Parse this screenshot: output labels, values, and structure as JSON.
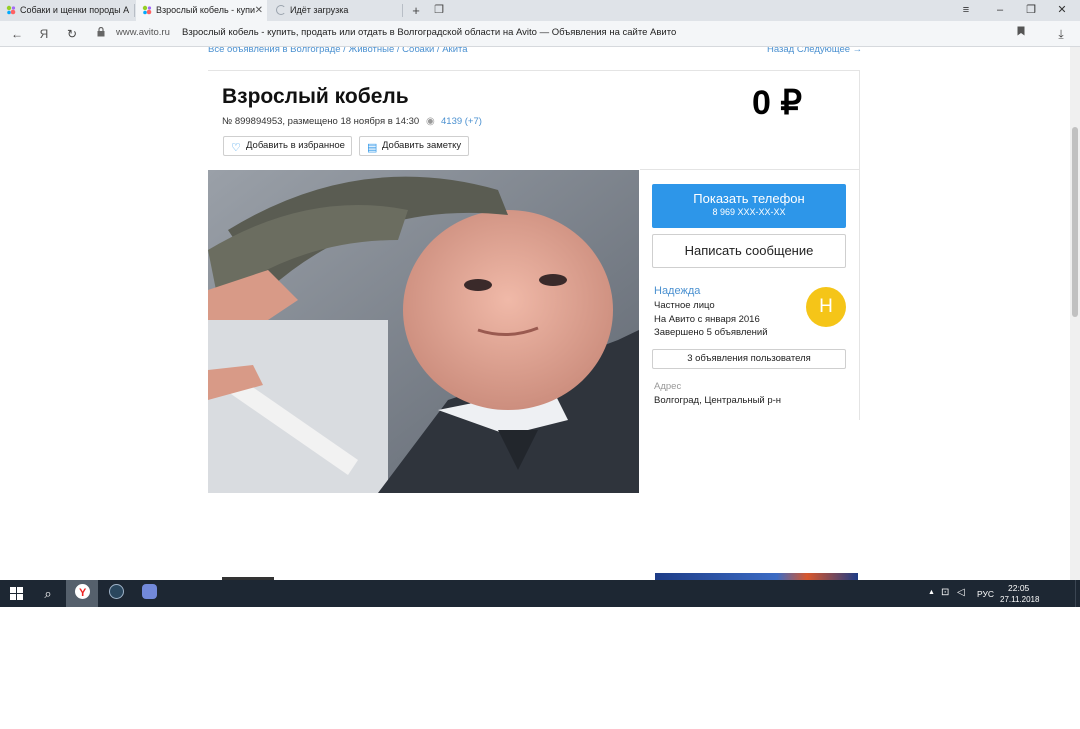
{
  "browser": {
    "tabs": [
      {
        "label": "Собаки и щенки породы А",
        "active": false
      },
      {
        "label": "Взрослый кобель - купи",
        "active": true
      },
      {
        "label": "Идёт загрузка",
        "active": false
      }
    ],
    "address": {
      "domain": "www.avito.ru",
      "title": "Взрослый кобель - купить, продать или отдать в Волгоградской области на Avito — Объявления на сайте Авито"
    },
    "colors": {
      "accent": "#2d96e9",
      "link": "#4a90d0"
    }
  },
  "page": {
    "breadcrumb": "Все объявления в Волгограде / Животные / Собаки / Акита",
    "nav_links": "Назад  Следующее →",
    "ad": {
      "title": "Взрослый кобель",
      "meta": "№ 899894953, размещено 18 ноября в 14:30",
      "views": "4139 (+7)",
      "price": "0 ₽",
      "favorite_label": "Добавить в избранное",
      "note_label": "Добавить заметку"
    },
    "contact": {
      "phone_button": "Показать телефон",
      "phone_masked": "8 969 XXX-XX-XX",
      "message_button": "Написать сообщение"
    },
    "seller": {
      "name": "Надежда",
      "type": "Частное лицо",
      "since": "На Авито с января 2016",
      "completed": "Завершено 5 объявлений",
      "avatar_letter": "Н",
      "avatar_color": "#f5c518",
      "user_ads_button": "3 объявления пользователя"
    },
    "address": {
      "label": "Адрес",
      "value": "Волгоград, Центральный р-н"
    }
  },
  "taskbar": {
    "language": "РУС",
    "time": "22:05",
    "date": "27.11.2018"
  }
}
